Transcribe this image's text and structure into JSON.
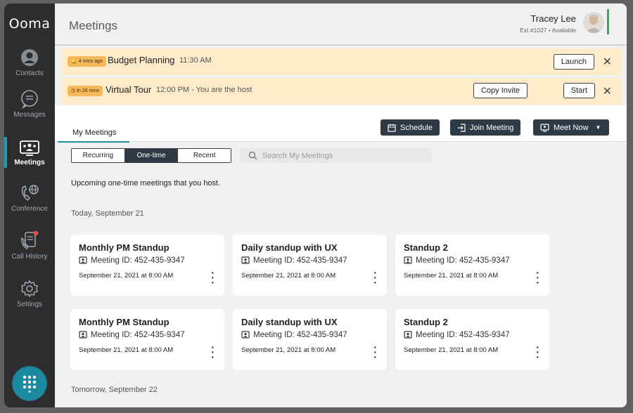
{
  "app": {
    "logo": "Ooma"
  },
  "sidebar": {
    "items": [
      {
        "label": "Contacts",
        "icon": "contacts-icon"
      },
      {
        "label": "Messages",
        "icon": "messages-icon"
      },
      {
        "label": "Meetings",
        "icon": "meetings-icon",
        "active": true
      },
      {
        "label": "Conference",
        "icon": "conference-icon"
      },
      {
        "label": "Call History",
        "icon": "call-history-icon"
      },
      {
        "label": "Settings",
        "icon": "settings-icon"
      }
    ],
    "dialpad_icon": "dialpad-icon"
  },
  "header": {
    "title": "Meetings",
    "user_name": "Tracey Lee",
    "user_status": "Ext #1027 • Available"
  },
  "banners": [
    {
      "badge": "4 mins ago",
      "title": "Budget Planning",
      "time": "11:30 AM",
      "actions": [
        "Launch"
      ]
    },
    {
      "badge": "In 26 mins",
      "title": "Virtual Tour",
      "time": "12:00 PM - You are the host",
      "actions": [
        "Copy Invite",
        "Start"
      ]
    }
  ],
  "main": {
    "tab_label": "My Meetings",
    "buttons": {
      "schedule": "Schedule",
      "join": "Join Meeting",
      "meet_now": "Meet Now"
    },
    "segments": [
      "Recurring",
      "One-time",
      "Recent"
    ],
    "active_segment": "One-time",
    "search_placeholder": "Search My Meetings",
    "intro": "Upcoming one-time meetings that you host.",
    "sections": [
      "Today, September 21",
      "Tomorrow, September 22"
    ],
    "cards": [
      {
        "title": "Monthly PM Standup",
        "meeting_id": "Meeting ID: 452-435-9347",
        "date": "September 21, 2021 at 8:00 AM"
      },
      {
        "title": "Daily standup with UX",
        "meeting_id": "Meeting ID: 452-435-9347",
        "date": "September 21, 2021 at 8:00 AM"
      },
      {
        "title": "Standup 2",
        "meeting_id": "Meeting ID: 452-435-9347",
        "date": "September 21, 2021 at 8:00 AM"
      },
      {
        "title": "Monthly PM Standup",
        "meeting_id": "Meeting ID: 452-435-9347",
        "date": "September 21, 2021 at 8:00 AM"
      },
      {
        "title": "Daily standup with UX",
        "meeting_id": "Meeting ID: 452-435-9347",
        "date": "September 21, 2021 at 8:00 AM"
      },
      {
        "title": "Standup 2",
        "meeting_id": "Meeting ID: 452-435-9347",
        "date": "September 21, 2021 at 8:00 AM"
      }
    ]
  },
  "colors": {
    "accent": "#1f9ab0",
    "banner": "#fdebc9",
    "dark_button": "#2e3a45",
    "sidebar": "#2b2d2f"
  }
}
